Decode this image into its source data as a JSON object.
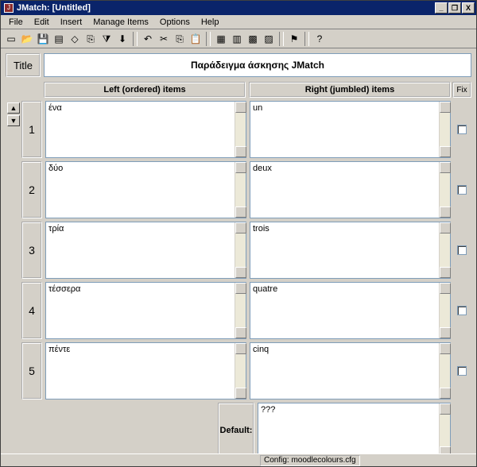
{
  "window": {
    "title": "JMatch: [Untitled]",
    "buttons": {
      "min": "_",
      "max": "❐",
      "close": "X"
    }
  },
  "menu": [
    "File",
    "Edit",
    "Insert",
    "Manage Items",
    "Options",
    "Help"
  ],
  "toolbar_icons": [
    "new",
    "open",
    "save",
    "save-all",
    "web",
    "export",
    "funnel",
    "down-arrow",
    "sep",
    "undo",
    "cut",
    "copy",
    "paste",
    "sep",
    "grid1",
    "grid2",
    "grid3",
    "grid4",
    "sep",
    "flag",
    "sep",
    "help"
  ],
  "toolbar_glyphs": {
    "new": "▭",
    "open": "📂",
    "save": "💾",
    "save-all": "▤",
    "web": "◇",
    "export": "⎘",
    "funnel": "⧩",
    "down-arrow": "⬇",
    "undo": "↶",
    "cut": "✂",
    "copy": "⎘",
    "paste": "📋",
    "grid1": "▦",
    "grid2": "▥",
    "grid3": "▩",
    "grid4": "▨",
    "flag": "⚑",
    "help": "?"
  },
  "labels": {
    "title": "Title",
    "left_header": "Left (ordered) items",
    "right_header": "Right (jumbled) items",
    "fix": "Fix",
    "default": "Default:"
  },
  "title_value": "Παράδειγμα άσκησης JMatch",
  "items": [
    {
      "num": "1",
      "left": "ένα",
      "right": "un"
    },
    {
      "num": "2",
      "left": "δύο",
      "right": "deux"
    },
    {
      "num": "3",
      "left": "τρία",
      "right": "trois"
    },
    {
      "num": "4",
      "left": "τέσσερα",
      "right": "quatre"
    },
    {
      "num": "5",
      "left": "πέντε",
      "right": "cinq"
    }
  ],
  "default_value": "???",
  "status": {
    "config": "Config: moodlecolours.cfg"
  }
}
